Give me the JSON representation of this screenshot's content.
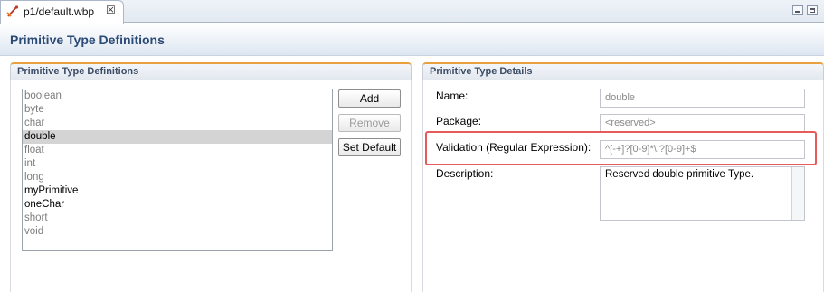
{
  "editor_tab": {
    "label": "p1/default.wbp",
    "icon": "wbp-file-icon"
  },
  "page": {
    "title": "Primitive Type Definitions"
  },
  "definitions_section": {
    "title": "Primitive Type Definitions",
    "items": [
      {
        "label": "boolean",
        "reserved": true
      },
      {
        "label": "byte",
        "reserved": true
      },
      {
        "label": "char",
        "reserved": true
      },
      {
        "label": "double",
        "reserved": true,
        "selected": true
      },
      {
        "label": "float",
        "reserved": true
      },
      {
        "label": "int",
        "reserved": true
      },
      {
        "label": "long",
        "reserved": true
      },
      {
        "label": "myPrimitive",
        "reserved": false
      },
      {
        "label": "oneChar",
        "reserved": false
      },
      {
        "label": "short",
        "reserved": true
      },
      {
        "label": "void",
        "reserved": true
      }
    ],
    "buttons": {
      "add": "Add",
      "remove": "Remove",
      "set_default": "Set Default"
    }
  },
  "details_section": {
    "title": "Primitive Type Details",
    "name_label": "Name:",
    "name_value": "double",
    "package_label": "Package:",
    "package_value": "<reserved>",
    "validation_label": "Validation (Regular Expression):",
    "validation_value": "^[-+]?[0-9]*\\.?[0-9]+$",
    "description_label": "Description:",
    "description_value": "Reserved double primitive Type."
  },
  "colors": {
    "section_accent": "#e9a040",
    "highlight_border": "#e55a5a",
    "title_text": "#2b4a75"
  }
}
